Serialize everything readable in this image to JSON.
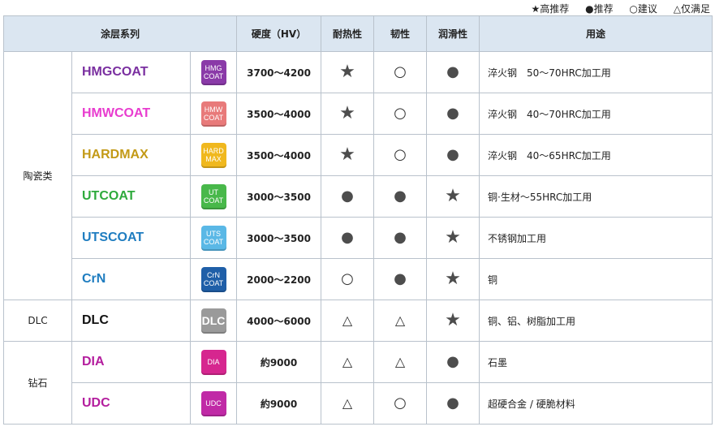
{
  "legend": [
    {
      "symbol": "★",
      "label": "高推荐"
    },
    {
      "symbol": "●",
      "label": "推荐"
    },
    {
      "symbol": "○",
      "label": "建议"
    },
    {
      "symbol": "△",
      "label": "仅满足"
    }
  ],
  "headers": {
    "coating": "涂层系列",
    "hardness": "硬度（HV）",
    "heat": "耐热性",
    "toughness": "韧性",
    "lubricity": "润滑性",
    "use": "用途"
  },
  "groups": {
    "ceramic": "陶瓷类",
    "dlc": "DLC",
    "diamond": "钻石"
  },
  "rows": [
    {
      "name": "HMGCOAT",
      "badge": "HMG\nCOAT",
      "hardness": "3700～4200",
      "heat": "★",
      "toughness": "○",
      "lubricity": "●",
      "use": "淬火钢　50～70HRC加工用",
      "name_color": "#7a2fa0",
      "badge_color": "#8a3aa8"
    },
    {
      "name": "HMWCOAT",
      "badge": "HMW\nCOAT",
      "hardness": "3500～4000",
      "heat": "★",
      "toughness": "○",
      "lubricity": "●",
      "use": "淬火钢　40～70HRC加工用",
      "name_color": "#e83ccf",
      "badge_color": "#e87a7a"
    },
    {
      "name": "HARDMAX",
      "badge": "HARD\nMAX",
      "hardness": "3500～4000",
      "heat": "★",
      "toughness": "○",
      "lubricity": "●",
      "use": "淬火钢　40～65HRC加工用",
      "name_color": "#c39a17",
      "badge_color": "#f0b81e"
    },
    {
      "name": "UTCOAT",
      "badge": "UT\nCOAT",
      "hardness": "3000～3500",
      "heat": "●",
      "toughness": "●",
      "lubricity": "★",
      "use": "铜·生材～55HRC加工用",
      "name_color": "#2eaa3c",
      "badge_color": "#48b84a"
    },
    {
      "name": "UTSCOAT",
      "badge": "UTS\nCOAT",
      "hardness": "3000～3500",
      "heat": "●",
      "toughness": "●",
      "lubricity": "★",
      "use": "不锈钢加工用",
      "name_color": "#1f7dc0",
      "badge_color": "#5ab8e6"
    },
    {
      "name": "CrN",
      "badge": "CrN\nCOAT",
      "hardness": "2000～2200",
      "heat": "○",
      "toughness": "●",
      "lubricity": "★",
      "use": "铜",
      "name_color": "#1f7dc0",
      "badge_color": "#1f5fa8"
    },
    {
      "name": "DLC",
      "badge": "DLC",
      "hardness": "4000～6000",
      "heat": "△",
      "toughness": "△",
      "lubricity": "★",
      "use": "铜、铝、树脂加工用",
      "name_color": "#111111",
      "badge_color": "#9a9a9a"
    },
    {
      "name": "DIA",
      "badge": "DIA",
      "hardness": "約9000",
      "heat": "△",
      "toughness": "△",
      "lubricity": "●",
      "use": "石墨",
      "name_color": "#b41e9e",
      "badge_color": "#d6268f"
    },
    {
      "name": "UDC",
      "badge": "UDC",
      "hardness": "約9000",
      "heat": "△",
      "toughness": "○",
      "lubricity": "●",
      "use": "超硬合金 / 硬脆材料",
      "name_color": "#b41e9e",
      "badge_color": "#c02aa6"
    }
  ]
}
